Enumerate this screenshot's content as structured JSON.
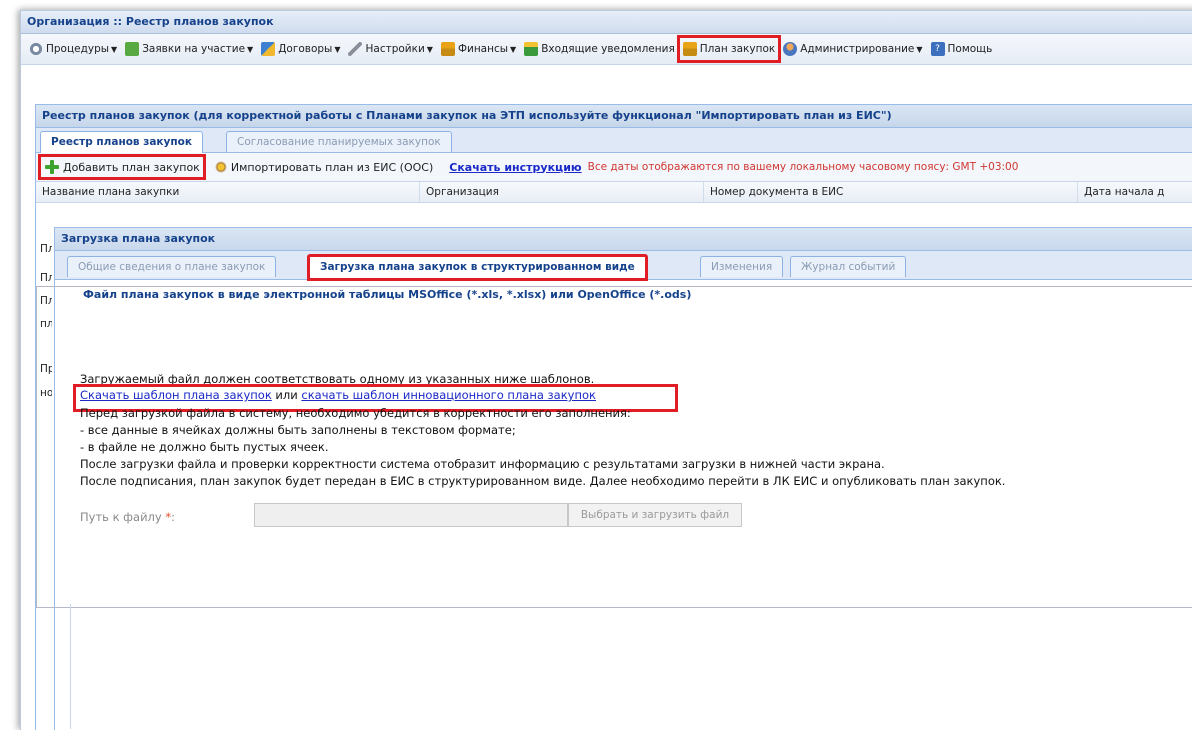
{
  "window": {
    "title": "Организация :: Реестр планов закупок"
  },
  "menu": [
    {
      "label": "Процедуры",
      "icon": "procedures-icon",
      "dropdown": true
    },
    {
      "label": "Заявки на участие",
      "icon": "applications-icon",
      "dropdown": true
    },
    {
      "label": "Договоры",
      "icon": "contracts-icon",
      "dropdown": true
    },
    {
      "label": "Настройки",
      "icon": "settings-icon",
      "dropdown": true
    },
    {
      "label": "Финансы",
      "icon": "finance-icon",
      "dropdown": true
    },
    {
      "label": "Входящие уведомления",
      "icon": "notifications-icon",
      "dropdown": false
    },
    {
      "label": "План закупок",
      "icon": "purchase-plan-icon",
      "dropdown": false
    },
    {
      "label": "Администрирование",
      "icon": "admin-icon",
      "dropdown": true
    },
    {
      "label": "Помощь",
      "icon": "help-icon",
      "dropdown": false
    }
  ],
  "panel": {
    "title": "Реестр планов закупок (для корректной работы с Планами закупок на ЭТП используйте функционал \"Импортировать план из ЕИС\")",
    "tabs": [
      "Реестр планов закупок",
      "Согласование планируемых закупок"
    ]
  },
  "toolbar": {
    "add_label": "Добавить план закупок",
    "import_label": "Импортировать план из ЕИС (ООС)",
    "instruction_link": "Скачать инструкцию",
    "timezone_note": "Все даты отображаются по вашему локальному часовому поясу: GMT +03:00"
  },
  "grid": {
    "columns": [
      "Название плана закупки",
      "Организация",
      "Номер документа в ЕИС",
      "Дата начала д"
    ],
    "row_stubs": [
      "Пл",
      "Пл",
      "Пл",
      "пла",
      "Пр",
      "ноя"
    ]
  },
  "dialog": {
    "title": "Загрузка плана закупок",
    "tabs": [
      "Общие сведения о плане закупок",
      "Загрузка плана закупок в структурированном виде",
      "Изменения",
      "Журнал событий"
    ],
    "fieldset_legend": "Файл плана закупок в виде электронной таблицы MSOffice (*.xls, *.xlsx) или OpenOffice (*.ods)",
    "intro": "Загружаемый файл должен соответствовать одному из указанных ниже шаблонов.",
    "template_link": "Скачать шаблон плана закупок",
    "or_text": " или ",
    "innov_template_link": "скачать шаблон инновационного плана закупок",
    "line_check": "Перед загрузкой файла в систему, необходимо убедится в корректности его заполнения:",
    "line_text_format": "- все данные в ячейках должны быть заполнены в текстовом формате;",
    "line_no_empty": "- в файле не должно быть пустых ячеек.",
    "line_after_upload": "После загрузки файла и проверки корректности система отобразит информацию с результатами загрузки в нижней части экрана.",
    "line_after_sign": "После подписания, план закупок будет передан в ЕИС в структурированном виде. Далее необходимо перейти в ЛК ЕИС и опубликовать план закупок.",
    "path_label": "Путь к файлу",
    "path_required": "*",
    "path_value": "",
    "upload_button": "Выбрать и загрузить файл"
  },
  "colors": {
    "accent": "#15428b",
    "highlight": "#e01c24",
    "link": "#1a29c8"
  }
}
